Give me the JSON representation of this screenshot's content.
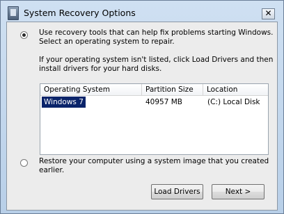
{
  "window": {
    "title": "System Recovery Options",
    "close_label": "✕"
  },
  "options": {
    "recovery_tools": {
      "line1": "Use recovery tools that can help fix problems starting Windows.",
      "line2": "Select an operating system to repair.",
      "selected": true
    },
    "info": {
      "line1": "If your operating system isn't listed, click Load Drivers and then",
      "line2": "install drivers for your hard disks."
    },
    "restore_image": {
      "line1": "Restore your computer using a system image that you created",
      "line2": "earlier.",
      "selected": false
    }
  },
  "table": {
    "columns": [
      "Operating System",
      "Partition Size",
      "Location"
    ],
    "rows": [
      {
        "os": "Windows 7",
        "size": "40957 MB",
        "location": "(C:) Local Disk",
        "selected": true
      }
    ]
  },
  "buttons": {
    "load_drivers": "Load Drivers",
    "next": "Next >"
  },
  "colors": {
    "selection": "#0a246a",
    "titlebar": "#b8cfe8"
  }
}
